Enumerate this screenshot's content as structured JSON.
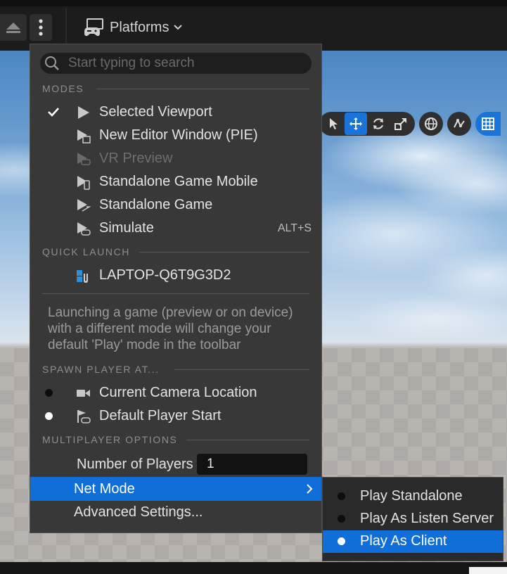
{
  "toolbar": {
    "platforms_label": "Platforms",
    "icons": [
      "eject-icon",
      "more-options-icon",
      "platforms-gamepad-icon",
      "chevron-down-icon"
    ]
  },
  "viewport_tools": {
    "icons": [
      "select-icon",
      "translate-icon",
      "rotate-icon",
      "scale-icon",
      "world-local-icon",
      "surface-snapping-icon",
      "grid-snap-icon"
    ],
    "active": [
      "translate-icon",
      "grid-snap-icon"
    ]
  },
  "menu": {
    "search_placeholder": "Start typing to search",
    "sections": {
      "modes": "MODES",
      "quick_launch": "QUICK LAUNCH",
      "spawn": "SPAWN PLAYER AT...",
      "multiplayer": "MULTIPLAYER OPTIONS"
    },
    "modes": [
      {
        "label": "Selected Viewport",
        "checked": true,
        "disabled": false,
        "shortcut": ""
      },
      {
        "label": "New Editor Window (PIE)",
        "checked": false,
        "disabled": false,
        "shortcut": ""
      },
      {
        "label": "VR Preview",
        "checked": false,
        "disabled": true,
        "shortcut": ""
      },
      {
        "label": "Standalone Game Mobile",
        "checked": false,
        "disabled": false,
        "shortcut": ""
      },
      {
        "label": "Standalone Game",
        "checked": false,
        "disabled": false,
        "shortcut": ""
      },
      {
        "label": "Simulate",
        "checked": false,
        "disabled": false,
        "shortcut": "ALT+S"
      }
    ],
    "quick_launch": [
      {
        "label": "LAPTOP-Q6T9G3D2"
      }
    ],
    "info_text": "Launching a game (preview or on device) with a different mode will change your default 'Play' mode in the toolbar",
    "spawn": [
      {
        "label": "Current Camera Location",
        "selected": false
      },
      {
        "label": "Default Player Start",
        "selected": true
      }
    ],
    "players_label": "Number of Players",
    "players_value": "1",
    "net_mode_label": "Net Mode",
    "advanced_label": "Advanced Settings..."
  },
  "net_mode_submenu": [
    {
      "label": "Play Standalone",
      "selected": false
    },
    {
      "label": "Play As Listen Server",
      "selected": false
    },
    {
      "label": "Play As Client",
      "selected": true
    }
  ],
  "colors": {
    "accent": "#0f6ed8",
    "menu_bg": "#383838",
    "toolbar_bg": "#1c1c1c"
  }
}
